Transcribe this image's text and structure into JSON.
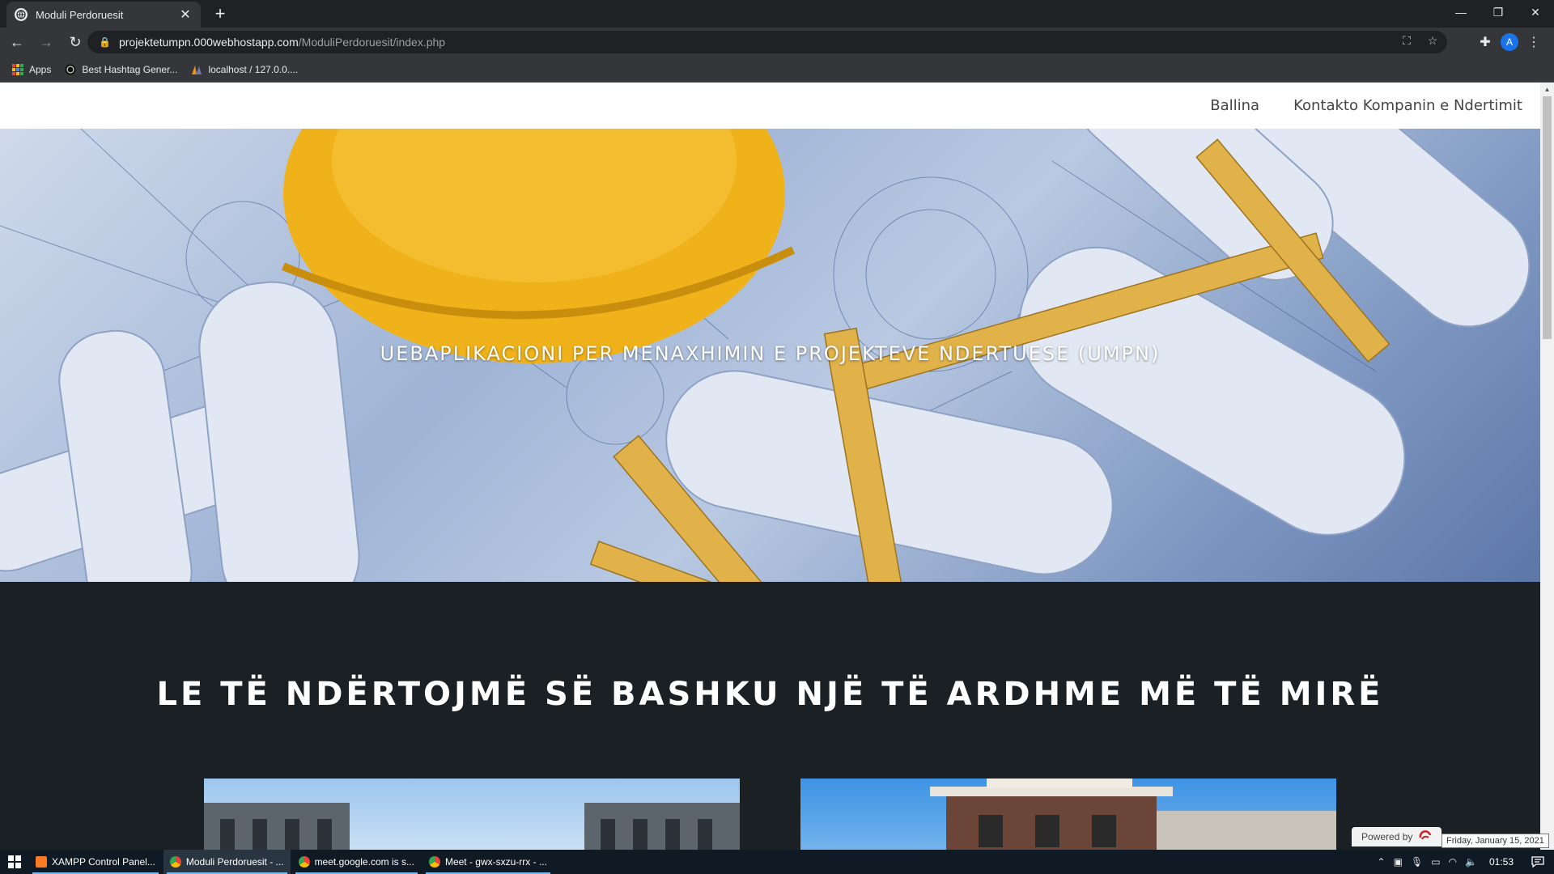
{
  "browser": {
    "tab_title": "Moduli Perdoruesit",
    "url_host": "projektetumpn.000webhostapp.com",
    "url_path": "/ModuliPerdoruesit/index.php",
    "avatar_letter": "A",
    "bookmarks": [
      {
        "label": "Apps",
        "icon": "apps-grid-icon"
      },
      {
        "label": "Best Hashtag Gener...",
        "icon": "hashtag-site-icon"
      },
      {
        "label": "localhost / 127.0.0....",
        "icon": "phpmyadmin-icon"
      }
    ]
  },
  "site": {
    "nav": [
      "Ballina",
      "Kontakto Kompanin e Ndertimit"
    ],
    "hero_title": "UEBAPLIKACIONI PER MENAXHIMIN E PROJEKTEVE NDERTUESE (UMPN)",
    "section_heading": "LE TË NDËRTOJMË SË BASHKU NJË TË ARDHME MË TË MIRË",
    "powered_by": "Powered by"
  },
  "taskbar": {
    "items": [
      {
        "label": "XAMPP Control Panel...",
        "icon_color": "#fb7a24"
      },
      {
        "label": "Moduli Perdoruesit - ...",
        "icon_color": "#4285f4"
      },
      {
        "label": "meet.google.com is s...",
        "icon_color": "#4285f4"
      },
      {
        "label": "Meet - gwx-sxzu-rrx - ...",
        "icon_color": "#4285f4"
      }
    ],
    "time": "01:53",
    "date_tooltip": "Friday, January 15, 2021"
  },
  "colors": {
    "chrome_dark": "#202124",
    "chrome_toolbar": "#35363a",
    "page_dark": "#1b2025",
    "helmet_yellow": "#f0b21a",
    "taskbar": "#101a24"
  }
}
